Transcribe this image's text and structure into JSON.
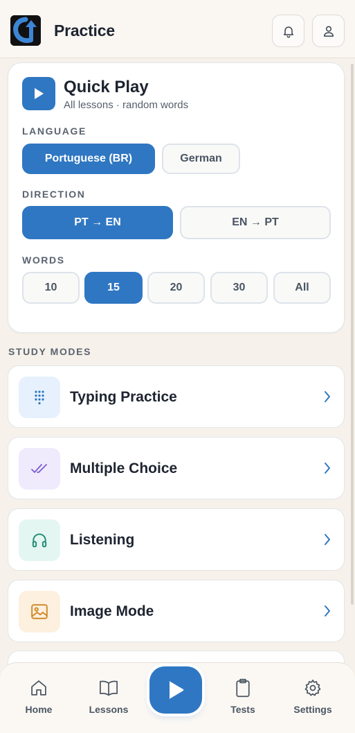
{
  "header": {
    "title": "Practice",
    "logo_icon": "app-logo-arrow",
    "notifications_icon": "bell-icon",
    "profile_icon": "user-icon"
  },
  "quick_play": {
    "title": "Quick Play",
    "subtitle": "All lessons · random words",
    "icon": "play-icon",
    "language": {
      "label": "LANGUAGE",
      "options": [
        "Portuguese (BR)",
        "German"
      ],
      "selected": "Portuguese (BR)"
    },
    "direction": {
      "label": "DIRECTION",
      "options": [
        "PT → EN",
        "EN → PT"
      ],
      "selected": "PT → EN"
    },
    "words": {
      "label": "WORDS",
      "options": [
        "10",
        "15",
        "20",
        "30",
        "All"
      ],
      "selected": "15"
    }
  },
  "study_modes": {
    "label": "STUDY MODES",
    "items": [
      {
        "label": "Typing Practice",
        "icon": "keypad-icon",
        "icon_bg": "#e6f1fd",
        "icon_color": "#2f77c2"
      },
      {
        "label": "Multiple Choice",
        "icon": "double-check-icon",
        "icon_bg": "#efeafc",
        "icon_color": "#7a5bd6"
      },
      {
        "label": "Listening",
        "icon": "headphones-icon",
        "icon_bg": "#e4f6f1",
        "icon_color": "#1f8a72"
      },
      {
        "label": "Image Mode",
        "icon": "image-icon",
        "icon_bg": "#fdf0df",
        "icon_color": "#d08a2a"
      }
    ]
  },
  "bottom_nav": {
    "items": [
      {
        "label": "Home",
        "icon": "home-icon"
      },
      {
        "label": "Lessons",
        "icon": "book-icon"
      },
      {
        "label": "Tests",
        "icon": "clipboard-icon"
      },
      {
        "label": "Settings",
        "icon": "gear-icon"
      }
    ],
    "center_icon": "play-icon"
  },
  "colors": {
    "accent": "#2f77c2",
    "background": "#f6f1ea",
    "text": "#1d2430"
  }
}
